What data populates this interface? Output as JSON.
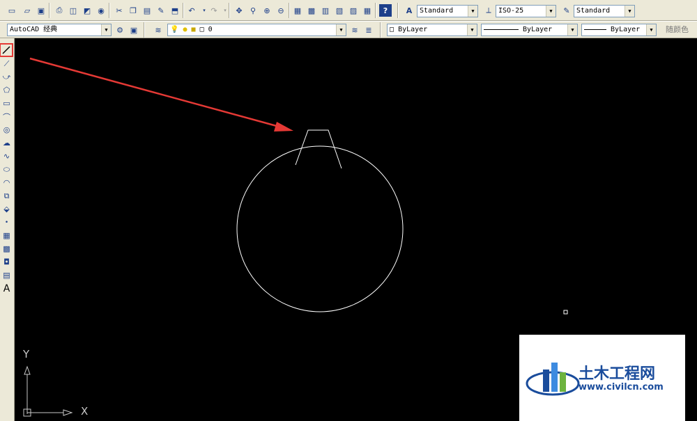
{
  "toolbar": {
    "text_style": "Standard",
    "dim_style": "ISO-25",
    "table_style": "Standard",
    "workspace": "AutoCAD 经典",
    "layer": "0",
    "color": "ByLayer",
    "linetype": "ByLayer",
    "lineweight": "ByLayer",
    "plot_style": "随颜色"
  },
  "canvas": {
    "axis_y_label": "Y",
    "axis_x_label": "X"
  },
  "watermark": {
    "title": "土木工程网",
    "url": "www.civilcn.com"
  },
  "colors": {
    "highlight": "#e53935",
    "arrow": "#e53935",
    "drawing": "#ffffff",
    "background": "#000000"
  }
}
